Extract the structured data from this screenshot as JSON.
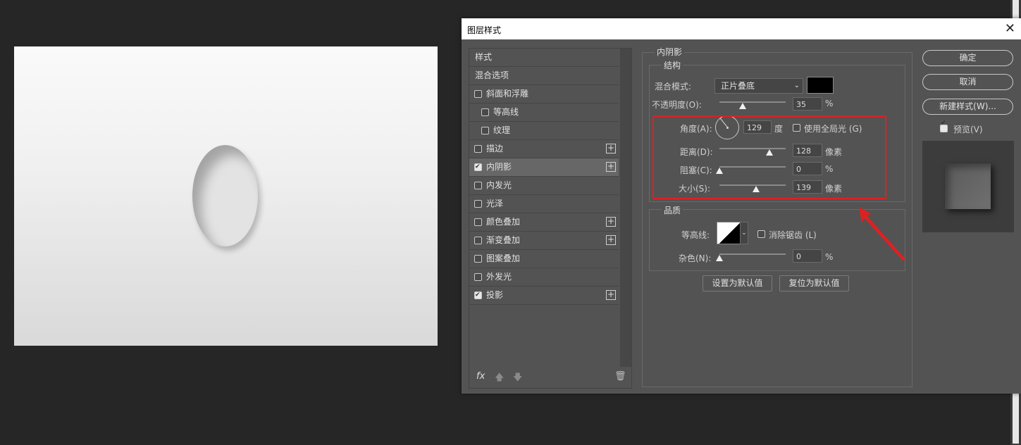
{
  "dialog": {
    "title": "图层样式",
    "close_icon": "close-icon"
  },
  "styles_panel": {
    "items": [
      {
        "label": "样式",
        "checkbox": false,
        "plus": false,
        "checked": false
      },
      {
        "label": "混合选项",
        "checkbox": false,
        "plus": false,
        "checked": false
      },
      {
        "label": "斜面和浮雕",
        "checkbox": true,
        "plus": false,
        "checked": false
      },
      {
        "label": "等高线",
        "checkbox": true,
        "plus": false,
        "checked": false,
        "sub": true
      },
      {
        "label": "纹理",
        "checkbox": true,
        "plus": false,
        "checked": false,
        "sub": true
      },
      {
        "label": "描边",
        "checkbox": true,
        "plus": true,
        "checked": false
      },
      {
        "label": "内阴影",
        "checkbox": true,
        "plus": true,
        "checked": true,
        "active": true
      },
      {
        "label": "内发光",
        "checkbox": true,
        "plus": false,
        "checked": false
      },
      {
        "label": "光泽",
        "checkbox": true,
        "plus": false,
        "checked": false
      },
      {
        "label": "颜色叠加",
        "checkbox": true,
        "plus": true,
        "checked": false
      },
      {
        "label": "渐变叠加",
        "checkbox": true,
        "plus": true,
        "checked": false
      },
      {
        "label": "图案叠加",
        "checkbox": true,
        "plus": false,
        "checked": false
      },
      {
        "label": "外发光",
        "checkbox": true,
        "plus": false,
        "checked": false
      },
      {
        "label": "投影",
        "checkbox": true,
        "plus": true,
        "checked": true
      }
    ],
    "footer": {
      "fx": "fx",
      "up": "🡅",
      "down": "🡇",
      "trash": "🗑"
    }
  },
  "inner_shadow": {
    "section_title": "内阴影",
    "structure_title": "结构",
    "blend_mode_label": "混合模式:",
    "blend_mode_value": "正片叠底",
    "blend_color": "#000000",
    "opacity_label": "不透明度(O):",
    "opacity_value": "35",
    "opacity_unit": "%",
    "opacity_level": 0.35,
    "angle_label": "角度(A):",
    "angle_value": "129",
    "angle_unit": "度",
    "global_light_label": "使用全局光 (G)",
    "global_light_checked": false,
    "distance_label": "距离(D):",
    "distance_value": "128",
    "distance_unit": "像素",
    "distance_level": 0.75,
    "choke_label": "阻塞(C):",
    "choke_value": "0",
    "choke_unit": "%",
    "choke_level": 0,
    "size_label": "大小(S):",
    "size_value": "139",
    "size_unit": "像素",
    "size_level": 0.55,
    "quality_title": "品质",
    "contour_label": "等高线:",
    "anti_alias_label": "消除锯齿 (L)",
    "anti_alias_checked": false,
    "noise_label": "杂色(N):",
    "noise_value": "0",
    "noise_unit": "%",
    "noise_level": 0,
    "set_default_label": "设置为默认值",
    "reset_default_label": "复位为默认值"
  },
  "right_buttons": {
    "ok": "确定",
    "cancel": "取消",
    "new_style": "新建样式(W)...",
    "preview_label": "预览(V)",
    "preview_checked": true
  },
  "colors": {
    "highlight": "#e02020"
  }
}
